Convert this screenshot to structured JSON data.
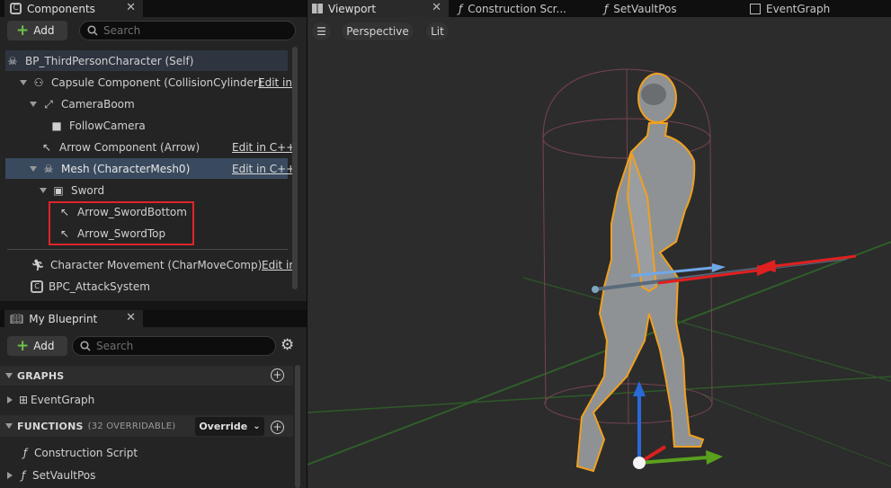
{
  "tabs": {
    "components": "Components",
    "viewport": "Viewport",
    "construction_script": "Construction Scr...",
    "set_vault_pos": "SetVaultPos",
    "event_graph": "EventGraph",
    "my_blueprint": "My Blueprint"
  },
  "components": {
    "add_label": "Add",
    "search_placeholder": "Search",
    "items": [
      {
        "label": "BP_ThirdPersonCharacter (Self)",
        "edit": ""
      },
      {
        "label": "Capsule Component (CollisionCylinder)",
        "edit": "Edit in"
      },
      {
        "label": "CameraBoom",
        "edit": ""
      },
      {
        "label": "FollowCamera",
        "edit": ""
      },
      {
        "label": "Arrow Component (Arrow)",
        "edit": "Edit in C++"
      },
      {
        "label": "Mesh (CharacterMesh0)",
        "edit": "Edit in C++"
      },
      {
        "label": "Sword",
        "edit": ""
      },
      {
        "label": "Arrow_SwordBottom",
        "edit": ""
      },
      {
        "label": "Arrow_SwordTop",
        "edit": ""
      },
      {
        "label": "Character Movement (CharMoveComp)",
        "edit": "Edit in"
      },
      {
        "label": "BPC_AttackSystem",
        "edit": ""
      }
    ]
  },
  "my_blueprint": {
    "add_label": "Add",
    "search_placeholder": "Search",
    "graphs_header": "GRAPHS",
    "graphs": [
      "EventGraph"
    ],
    "functions_header": "FUNCTIONS",
    "functions_note": "(32 OVERRIDABLE)",
    "override_label": "Override",
    "functions": [
      "Construction Script",
      "SetVaultPos"
    ]
  },
  "viewport": {
    "perspective_label": "Perspective",
    "lit_label": "Lit"
  },
  "colors": {
    "selection": "#3a4a5e",
    "highlight_box": "#e0242a",
    "add_plus": "#6cc24a",
    "outline": "#f0a020"
  }
}
